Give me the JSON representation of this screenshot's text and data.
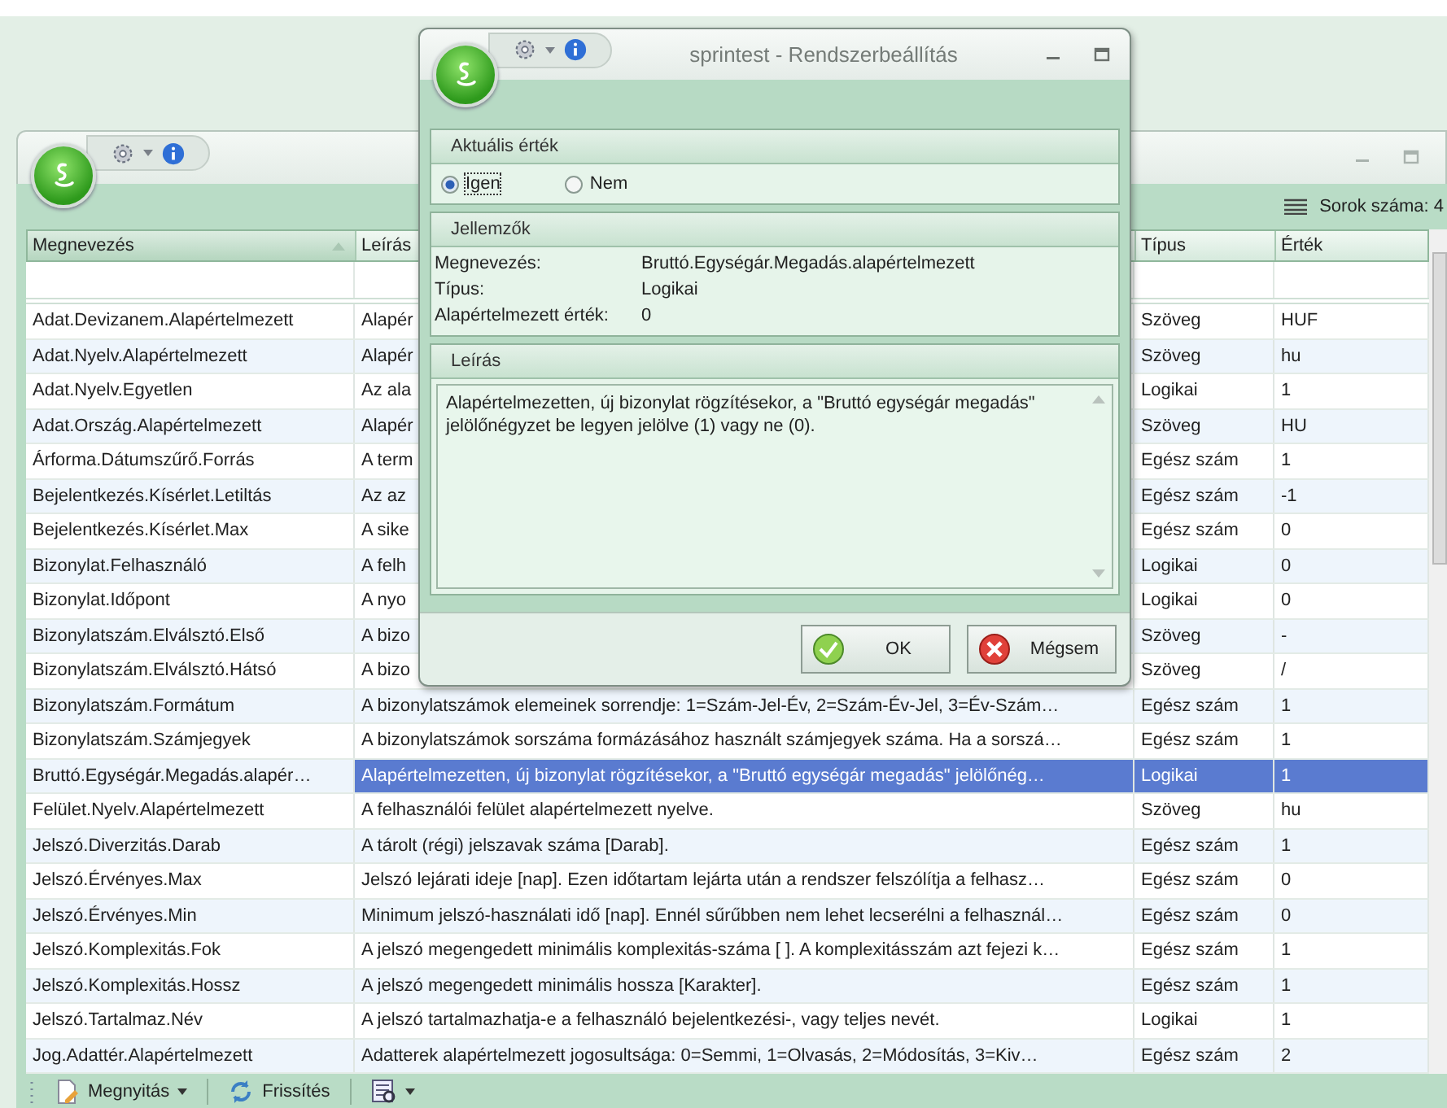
{
  "main_window": {
    "row_count_label": "Sorok száma: 4"
  },
  "table": {
    "columns": [
      {
        "label": "Megnevezés",
        "sorted": true
      },
      {
        "label": "Leírás",
        "sorted": false
      },
      {
        "label": "Típus",
        "sorted": false
      },
      {
        "label": "Érték",
        "sorted": false
      }
    ],
    "rows": [
      {
        "name": "Adat.Devizanem.Alapértelmezett",
        "description": "Alapér",
        "type": "Szöveg",
        "value": "HUF",
        "selected": false
      },
      {
        "name": "Adat.Nyelv.Alapértelmezett",
        "description": "Alapér",
        "type": "Szöveg",
        "value": "hu",
        "selected": false
      },
      {
        "name": "Adat.Nyelv.Egyetlen",
        "description": "Az ala",
        "type": "Logikai",
        "value": "1",
        "selected": false
      },
      {
        "name": "Adat.Ország.Alapértelmezett",
        "description": "Alapér",
        "type": "Szöveg",
        "value": "HU",
        "selected": false
      },
      {
        "name": "Árforma.Dátumszűrő.Forrás",
        "description": "A term",
        "type": "Egész szám",
        "value": "1",
        "selected": false
      },
      {
        "name": "Bejelentkezés.Kísérlet.Letiltás",
        "description": "Az az",
        "type": "Egész szám",
        "value": "-1",
        "selected": false
      },
      {
        "name": "Bejelentkezés.Kísérlet.Max",
        "description": "A sike",
        "type": "Egész szám",
        "value": "0",
        "selected": false
      },
      {
        "name": "Bizonylat.Felhasználó",
        "description": "A felh",
        "type": "Logikai",
        "value": "0",
        "selected": false
      },
      {
        "name": "Bizonylat.Időpont",
        "description": "A nyo",
        "type": "Logikai",
        "value": "0",
        "selected": false
      },
      {
        "name": "Bizonylatszám.Elválsztó.Első",
        "description": "A bizo",
        "type": "Szöveg",
        "value": "-",
        "selected": false
      },
      {
        "name": "Bizonylatszám.Elválsztó.Hátsó",
        "description": "A bizo",
        "type": "Szöveg",
        "value": "/",
        "selected": false
      },
      {
        "name": "Bizonylatszám.Formátum",
        "description": "A bizonylatszámok elemeinek sorrendje: 1=Szám-Jel-Év, 2=Szám-Év-Jel, 3=Év-Szám…",
        "type": "Egész szám",
        "value": "1",
        "selected": false
      },
      {
        "name": "Bizonylatszám.Számjegyek",
        "description": "A bizonylatszámok sorszáma formázásához használt számjegyek száma. Ha a sorszá…",
        "type": "Egész szám",
        "value": "1",
        "selected": false
      },
      {
        "name": "Bruttó.Egységár.Megadás.alapér…",
        "description": "Alapértelmezetten, új bizonylat rögzítésekor, a \"Bruttó egységár megadás\" jelölőnég…",
        "type": "Logikai",
        "value": "1",
        "selected": true
      },
      {
        "name": "Felület.Nyelv.Alapértelmezett",
        "description": "A felhasználói felület alapértelmezett nyelve.",
        "type": "Szöveg",
        "value": "hu",
        "selected": false
      },
      {
        "name": "Jelszó.Diverzitás.Darab",
        "description": "A tárolt (régi) jelszavak száma [Darab].",
        "type": "Egész szám",
        "value": "1",
        "selected": false
      },
      {
        "name": "Jelszó.Érvényes.Max",
        "description": "Jelszó lejárati ideje [nap]. Ezen időtartam lejárta után a rendszer felszólítja a felhasz…",
        "type": "Egész szám",
        "value": "0",
        "selected": false
      },
      {
        "name": "Jelszó.Érvényes.Min",
        "description": "Minimum jelszó-használati idő [nap]. Ennél sűrűbben nem lehet lecserélni a felhasznál…",
        "type": "Egész szám",
        "value": "0",
        "selected": false
      },
      {
        "name": "Jelszó.Komplexitás.Fok",
        "description": "A jelszó megengedett minimális komplexitás-száma [ ]. A komplexitásszám azt fejezi k…",
        "type": "Egész szám",
        "value": "1",
        "selected": false
      },
      {
        "name": "Jelszó.Komplexitás.Hossz",
        "description": "A jelszó megengedett minimális hossza [Karakter].",
        "type": "Egész szám",
        "value": "1",
        "selected": false
      },
      {
        "name": "Jelszó.Tartalmaz.Név",
        "description": "A jelszó tartalmazhatja-e a felhasználó bejelentkezési-, vagy teljes nevét.",
        "type": "Logikai",
        "value": "1",
        "selected": false
      },
      {
        "name": "Jog.Adattér.Alapértelmezett",
        "description": "Adatterek alapértelmezett jogosultsága: 0=Semmi, 1=Olvasás, 2=Módosítás, 3=Kiv…",
        "type": "Egész szám",
        "value": "2",
        "selected": false
      }
    ]
  },
  "bottom_toolbar": {
    "open_button": "Megnyitás",
    "refresh_button": "Frissítés"
  },
  "dialog": {
    "title": "sprintest - Rendszerbeállítás",
    "current_value": {
      "heading": "Aktuális érték",
      "options": [
        {
          "label": "Igen",
          "selected": true
        },
        {
          "label": "Nem",
          "selected": false
        }
      ]
    },
    "properties": {
      "heading": "Jellemzők",
      "items": [
        {
          "label": "Megnevezés:",
          "value": "Bruttó.Egységár.Megadás.alapértelmezett"
        },
        {
          "label": "Típus:",
          "value": "Logikai"
        },
        {
          "label": "Alapértelmezett érték:",
          "value": "0"
        }
      ]
    },
    "description": {
      "heading": "Leírás",
      "text": "Alapértelmezetten, új bizonylat rögzítésekor, a \"Bruttó egységár megadás\" jelölőnégyzet be legyen jelölve (1) vagy ne (0)."
    },
    "buttons": [
      {
        "label": "OK",
        "kind": "ok"
      },
      {
        "label": "Mégsem",
        "kind": "cancel"
      }
    ]
  }
}
